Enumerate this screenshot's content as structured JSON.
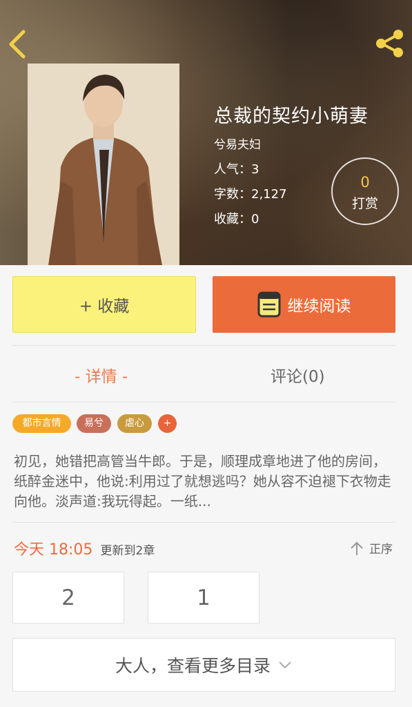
{
  "book": {
    "title": "总裁的契约小萌妻",
    "author": "兮易夫妇",
    "popularity": "人气：3",
    "word_count": "字数：2,127",
    "favorites": "收藏：0"
  },
  "tip": {
    "count": "0",
    "label": "打赏"
  },
  "actions": {
    "favorite_label": "+ 收藏",
    "read_label": "继续阅读"
  },
  "tabs": [
    {
      "label": "- 详情 -",
      "active": true
    },
    {
      "label": "评论(0)",
      "active": false
    }
  ],
  "tags": [
    {
      "label": "都市言情",
      "color": "#f4a928"
    },
    {
      "label": "易兮",
      "color": "#c9705a"
    },
    {
      "label": "虐心",
      "color": "#c99a3e"
    },
    {
      "label": "+",
      "color": "#e8643a"
    }
  ],
  "description": "初见，她错把高管当牛郎。于是，顺理成章地进了他的房间，纸醉金迷中，他说:利用过了就想逃吗？她从容不迫褪下衣物走向他。淡声道:我玩得起。一纸...",
  "update": {
    "today": "今天 18:05",
    "chapter": "更新到2章"
  },
  "order_label": "正序",
  "chapters": [
    "2",
    "1"
  ],
  "more_label": "大人，查看更多目录",
  "colors": {
    "accent": "#ec6b3b",
    "favorite_bg": "#fbf27b",
    "tip_number": "#f2c94c"
  },
  "icons": {
    "back": "chevron-left-icon",
    "share": "share-icon",
    "book": "book-icon",
    "sort": "arrow-up-icon",
    "more": "chevron-down-icon"
  }
}
